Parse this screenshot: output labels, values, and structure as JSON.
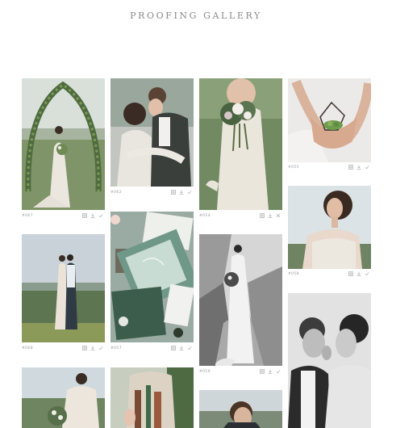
{
  "gallery": {
    "title": "PROOFING GALLERY"
  },
  "photos": [
    {
      "number": "#067",
      "subject": "bride under flower arch"
    },
    {
      "number": "#062",
      "subject": "couple embracing"
    },
    {
      "number": "#054",
      "subject": "bride holding bouquet"
    },
    {
      "number": "#055",
      "subject": "hands holding terrarium"
    },
    {
      "number": "#068",
      "subject": "couple on hill"
    },
    {
      "number": "#057",
      "subject": "invitation flat lay"
    },
    {
      "number": "#059",
      "subject": "bride on rocks"
    },
    {
      "number": "#058",
      "subject": "bride portrait"
    },
    {
      "number": "",
      "subject": "bride with bouquet"
    },
    {
      "number": "",
      "subject": "bouquet closeup"
    },
    {
      "number": "",
      "subject": "groom portrait"
    },
    {
      "number": "",
      "subject": "couple black and white"
    }
  ],
  "icons": {
    "zoom": "zoom-icon",
    "download": "download-icon",
    "approve": "check-icon",
    "reject": "close-icon"
  },
  "colors": {
    "title": "#8a8a8a",
    "meta": "#9a9a9a",
    "icon": "#a0a0a0"
  }
}
